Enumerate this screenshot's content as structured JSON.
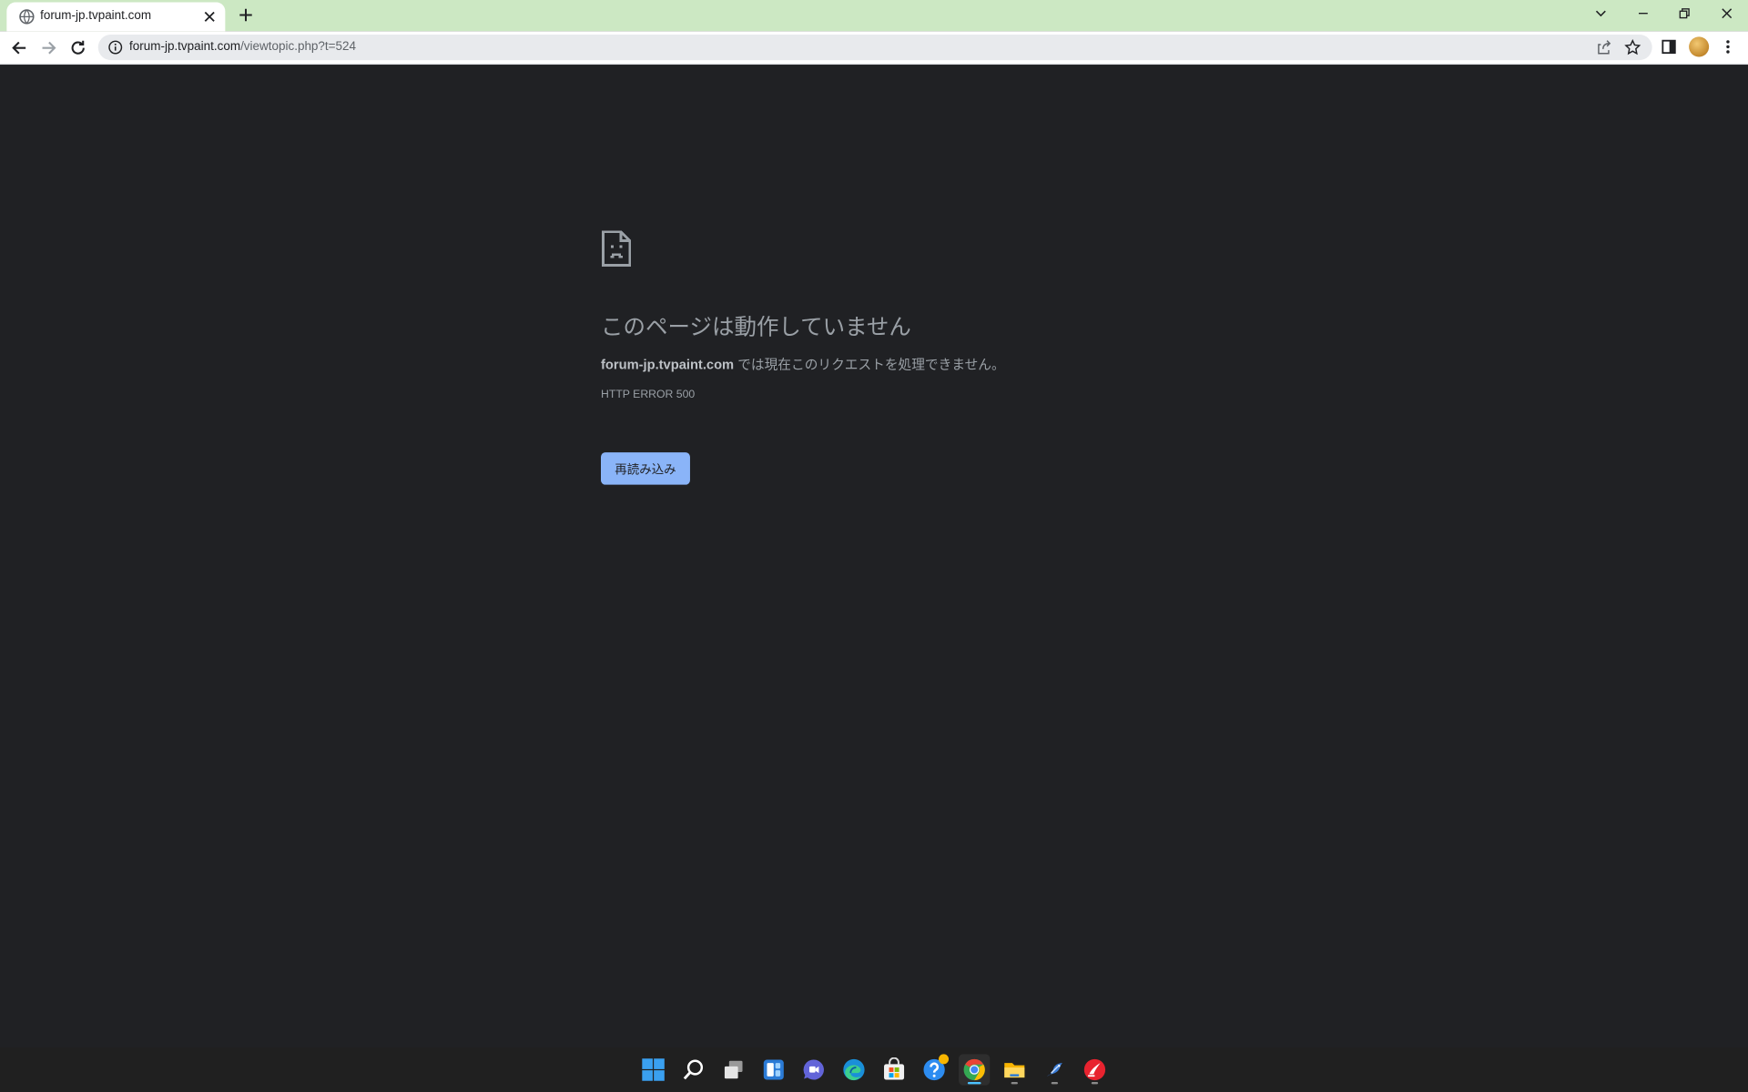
{
  "browser": {
    "tab": {
      "title": "forum-jp.tvpaint.com"
    },
    "address": {
      "host": "forum-jp.tvpaint.com",
      "path": "/viewtopic.php?t=524"
    },
    "icons": [
      "globe-icon",
      "close-icon",
      "plus-icon",
      "chevron-down-icon",
      "minimize-icon",
      "restore-icon",
      "close-window-icon",
      "back-arrow-icon",
      "forward-arrow-icon",
      "reload-icon",
      "info-icon",
      "share-icon",
      "star-icon",
      "side-panel-icon",
      "kebab-menu-icon"
    ]
  },
  "error_page": {
    "heading": "このページは動作していません",
    "host": "forum-jp.tvpaint.com",
    "message": " では現在このリクエストを処理できません。",
    "code": "HTTP ERROR 500",
    "reload_label": "再読み込み"
  },
  "colors": {
    "tab_strip": "#cce8c3",
    "page_background": "#202124",
    "text_secondary": "#9aa0a6",
    "button_blue": "#8ab4f8",
    "taskbar": "#202020"
  },
  "taskbar": {
    "apps": [
      "start",
      "search",
      "task-view",
      "widgets",
      "chat",
      "edge",
      "store",
      "get-help",
      "chrome",
      "file-explorer",
      "app-bird",
      "app-red"
    ],
    "active_app": "chrome"
  }
}
